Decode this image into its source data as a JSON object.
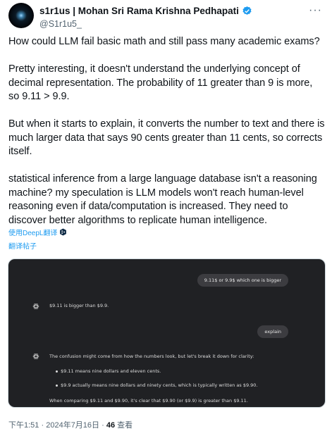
{
  "author": {
    "display_name": "s1r1us | Mohan Sri Rama Krishna Pedhapati",
    "handle": "@S1r1u5_"
  },
  "more_label": "···",
  "tweet_text": "How could LLM fail basic math and still pass many academic exams?\n\nPretty interesting, it doesn't understand the underlying concept of decimal representation. The probability of 11 greater than 9 is more, so 9.11 > 9.9.\n\nBut when it starts to explain, it converts the number to text and there is much larger data that says 90 cents greater than 11 cents, so corrects itself.\n\nstatistical inference from a large language database isn't a reasoning machine? my speculation is LLM models won't reach human-level reasoning even if data/computation is increased. They need to discover better algorithms to replicate human intelligence.",
  "translate": {
    "deepl_label": "使用DeepL翻译",
    "translate_post_label": "翻译帖子"
  },
  "media": {
    "user_msg_1": "9.11$ or 9.9$ which one is bigger",
    "assistant_msg_1": "$9.11 is bigger than $9.9.",
    "user_msg_2": "explain",
    "assistant_msg_2": {
      "intro": "The confusion might come from how the numbers look, but let's break it down for clarity:",
      "bullet_1": "$9.11 means nine dollars and eleven cents.",
      "bullet_2": "$9.9 actually means nine dollars and ninety cents, which is typically written as $9.90.",
      "conclusion": "When comparing $9.11 and $9.90, it's clear that $9.90 (or $9.9) is greater than $9.11."
    }
  },
  "meta": {
    "time": "下午1:51",
    "separator": "·",
    "date": "2024年7月16日",
    "views_count": "46",
    "views_label": "查看"
  },
  "colors": {
    "link": "#1d9bf0",
    "verified": "#1d9bf0",
    "media_bg": "#202124",
    "bubble_bg": "#3c3c40"
  }
}
